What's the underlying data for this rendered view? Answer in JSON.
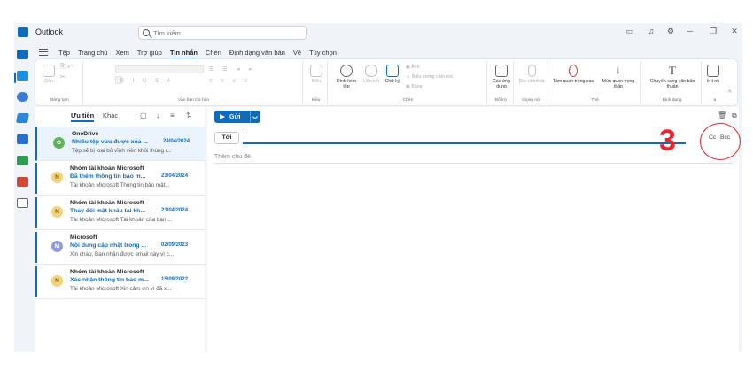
{
  "app": {
    "title": "Outlook"
  },
  "search": {
    "placeholder": "Tìm kiếm"
  },
  "window_controls": {
    "minimize": "─",
    "restore": "❐",
    "close": "✕"
  },
  "ribbon_tabs": [
    "Tệp",
    "Trang chủ",
    "Xem",
    "Trợ giúp",
    "Tin nhắn",
    "Chèn",
    "Định dạng văn bản",
    "Vẽ",
    "Tùy chọn"
  ],
  "active_tab": "Tin nhắn",
  "ribbon": {
    "clipboard": {
      "paste": "Dán",
      "group_label": "Bảng tạm"
    },
    "basic_text": {
      "group_label": "Văn bản Cơ bản",
      "format_glyphs": "B I U S A"
    },
    "styles": {
      "button": "Kiểu",
      "group_label": "Kiểu"
    },
    "insert": {
      "attach": "Đính kèm tệp",
      "link": "Liên kết",
      "signature": "Chữ ký",
      "image": "Ảnh",
      "emoji": "Biểu tượng cảm xúc",
      "table": "Bảng",
      "group_label": "Chèn"
    },
    "addins": {
      "apps": "Các ứng dụng",
      "group_label": "Bổ trợ"
    },
    "voice": {
      "dictate": "Đọc chính tả",
      "group_label": "Giọng nói"
    },
    "tags": {
      "high": "Tầm quan trọng cao",
      "low": "Mức quan trọng thấp",
      "group_label": "Thẻ"
    },
    "format": {
      "plain": "Chuyển sang văn bản thuần",
      "group_label": "Định dạng"
    },
    "print": {
      "label": "In t nh"
    },
    "more": {
      "group_label": "a"
    }
  },
  "list": {
    "tab_focused": "Ưu tiên",
    "tab_other": "Khác",
    "items": [
      {
        "avatar": "O",
        "sender": "OneDrive",
        "subject": "Nhiều tệp vừa được xóa ...",
        "date": "24/04/2024",
        "preview": "Tệp sẽ bị loại bỏ vĩnh viễn khỏi thùng r..."
      },
      {
        "avatar": "N",
        "sender": "Nhóm tài khoản Microsoft",
        "subject": "Đã thêm thông tin bảo m...",
        "date": "23/04/2024",
        "preview": "Tài khoản Microsoft Thông tin bảo mật..."
      },
      {
        "avatar": "N",
        "sender": "Nhóm tài khoản Microsoft",
        "subject": "Thay đổi mật khẩu tài kh...",
        "date": "23/04/2024",
        "preview": "Tài khoản Microsoft Tài khoản của bạn ..."
      },
      {
        "avatar": "M",
        "sender": "Microsoft",
        "subject": "Nội dung cập nhật trong ...",
        "date": "02/09/2023",
        "preview": "Xin chào, Bạn nhận được email này vì c..."
      },
      {
        "avatar": "N",
        "sender": "Nhóm tài khoản Microsoft",
        "subject": "Xác nhận thông tin bảo m...",
        "date": "15/09/2022",
        "preview": "Tài khoản Microsoft Xin cảm ơn vì đã x..."
      }
    ]
  },
  "compose": {
    "send_label": "Gửi",
    "to_label": "Tới",
    "cc": "Cc",
    "bcc": "Bcc",
    "subject_placeholder": "Thêm chủ đề"
  },
  "annotation": {
    "step": "3"
  },
  "colors": {
    "accent": "#0f6cbd",
    "annotation": "#e8262b",
    "avatar_o": "#5fb45a",
    "avatar_n": "#f3d27a",
    "avatar_m": "#8f9cde"
  }
}
